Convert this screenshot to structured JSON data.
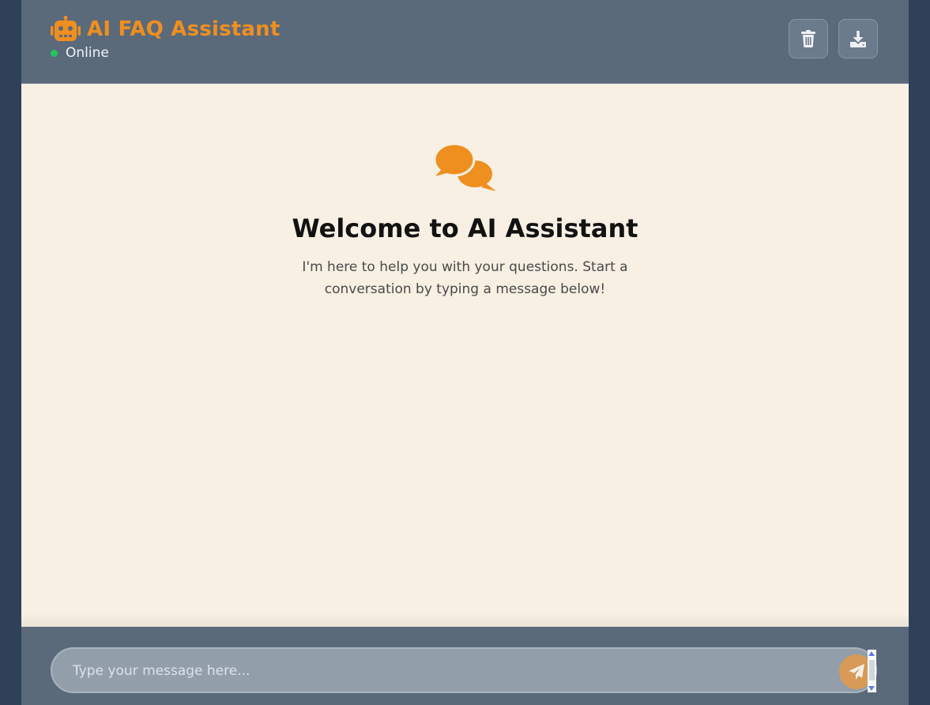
{
  "header": {
    "title": "AI FAQ Assistant",
    "status": "Online",
    "icons": {
      "logo": "robot-icon",
      "clear": "trash-icon",
      "export": "download-icon"
    }
  },
  "welcome": {
    "icon": "chat-bubbles-icon",
    "title": "Welcome to AI Assistant",
    "text": "I'm here to help you with your questions. Start a conversation by typing a message below!"
  },
  "composer": {
    "placeholder": "Type your message here...",
    "value": "",
    "send_icon": "paper-plane-icon"
  },
  "colors": {
    "accent": "#ef8f1f",
    "header_bg": "#5a6a7b",
    "content_bg": "#f7f0e3",
    "online": "#22c55e",
    "page_bg": "#2f4158"
  }
}
